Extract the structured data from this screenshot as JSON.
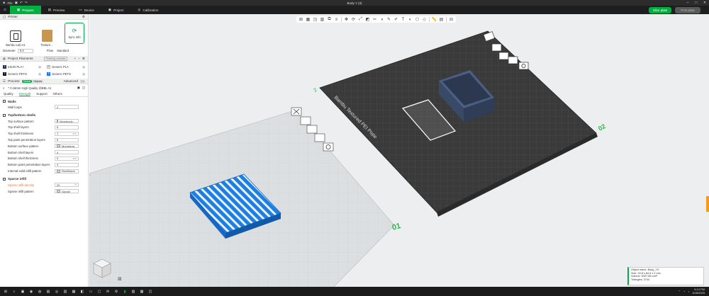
{
  "titlebar": {
    "app_label": "File",
    "doc_title": "Body Y (3)"
  },
  "nav": {
    "tabs": [
      {
        "label": "Prepare"
      },
      {
        "label": "Preview"
      },
      {
        "label": "Device"
      },
      {
        "label": "Project"
      },
      {
        "label": "Calibration"
      }
    ],
    "slice_label": "Slice plate",
    "print_label": "Print plate"
  },
  "printer": {
    "header": "Printer",
    "name": "Bambu Lab A1",
    "plate": "Texture...",
    "sync_label": "Sync info",
    "diameter_label": "Diameter",
    "diameter_value": "0.4",
    "flow_label": "Flow",
    "flow_value": "Standard"
  },
  "filaments": {
    "header": "Project Filaments",
    "auto_label": "Flushing volumes",
    "items": [
      {
        "num": "1",
        "name": "eSUN PLA+"
      },
      {
        "num": "2",
        "name": "Generic PLA"
      },
      {
        "num": "3",
        "name": "Generic PETG"
      },
      {
        "num": "4",
        "name": "Generic PETG"
      }
    ]
  },
  "process": {
    "header": "Process",
    "global": "Global",
    "objects": "Objects",
    "advanced": "Advanced",
    "profile": "* 0.16mm High Quality @BBL A1",
    "tabs": [
      "Quality",
      "Strength",
      "Support",
      "Others"
    ]
  },
  "walls": {
    "title": "Walls",
    "wall_loops_label": "Wall loops",
    "wall_loops": "2"
  },
  "shells": {
    "title": "Top/bottom shells",
    "options": [
      {
        "label": "Top surface pattern",
        "value": "Monotonic...",
        "unit": ""
      },
      {
        "label": "Top shell layers",
        "value": "6",
        "unit": ""
      },
      {
        "label": "Top shell thickness",
        "value": "1",
        "unit": "mm"
      },
      {
        "label": "Top paint penetration layers",
        "value": "6",
        "unit": ""
      },
      {
        "label": "Bottom surface pattern",
        "value": "Monotonic",
        "unit": ""
      },
      {
        "label": "Bottom shell layers",
        "value": "4",
        "unit": ""
      },
      {
        "label": "Bottom shell thickness",
        "value": "0",
        "unit": "mm"
      },
      {
        "label": "Bottom paint penetration layers",
        "value": "4",
        "unit": ""
      },
      {
        "label": "Internal solid infill pattern",
        "value": "Rectilinear",
        "unit": ""
      }
    ]
  },
  "infill": {
    "title": "Sparse infill",
    "density_label": "Sparse infill density",
    "density": "20",
    "density_unit": "%",
    "pattern_label": "Sparse infill pattern",
    "pattern": "Gyroid"
  },
  "viewport": {
    "plate1_label": "01",
    "plate2_label": "02",
    "plate_brand": "Bambu Textured PEI Plate"
  },
  "info": {
    "lines": [
      "Object name: Body_Y3",
      "Size: 94.8 x 84.5 x 2 mm",
      "Volume: 6337.85 mm³",
      "Triangles: 3734"
    ]
  },
  "taskbar": {
    "time": "9:13 PM",
    "date": "10/8/2025"
  }
}
